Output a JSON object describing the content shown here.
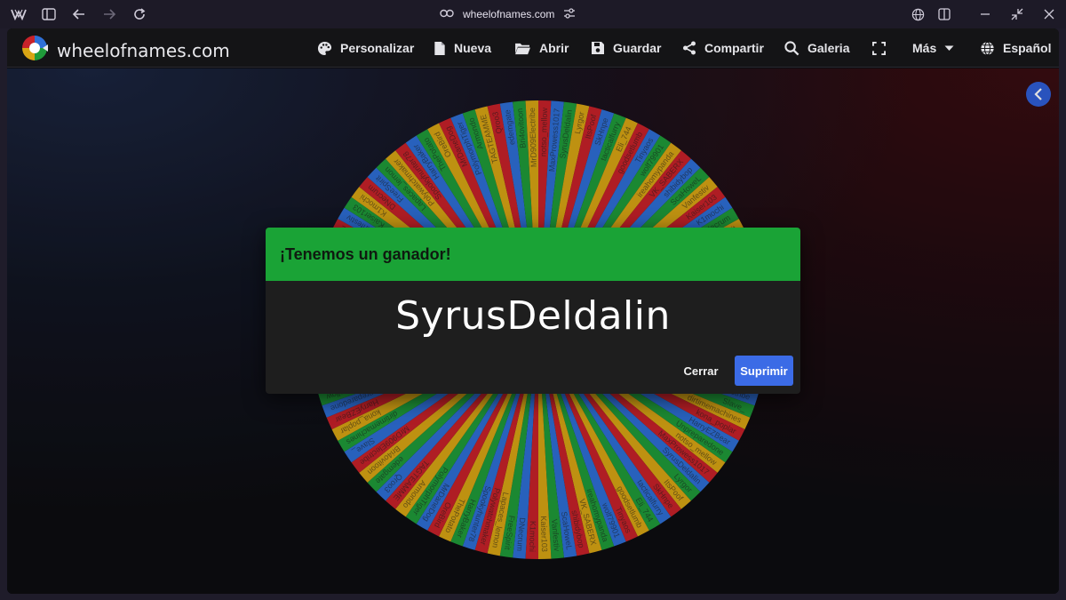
{
  "browser": {
    "url": "wheelofnames.com"
  },
  "app": {
    "brand_name": "wheelofnames.com",
    "nav": [
      {
        "label": "Personalizar",
        "icon": "palette-icon"
      },
      {
        "label": "Nueva",
        "icon": "file-icon"
      },
      {
        "label": "Abrir",
        "icon": "folder-icon"
      },
      {
        "label": "Guardar",
        "icon": "save-icon"
      },
      {
        "label": "Compartir",
        "icon": "share-icon"
      },
      {
        "label": "Galeria",
        "icon": "search-icon"
      },
      {
        "label": "",
        "icon": "fullscreen-icon"
      },
      {
        "label": "Más",
        "icon": "caret-down-icon"
      },
      {
        "label": "Español",
        "icon": "globe-icon"
      }
    ]
  },
  "wheel": {
    "segment_colors": [
      "#c8222a",
      "#2e6fd6",
      "#1f9b3a",
      "#d9a514"
    ],
    "visible_labels": [
      "notso_mellow",
      "MaxProwess1017",
      "SyrusDeldalin",
      "Lyrgor",
      "ItsPoof",
      "SkHnpe",
      "tacticalfurry",
      "Eli_744",
      "goodsetlumb",
      "Tinyaos",
      "wolf79901",
      "ireahomypanda",
      "VK_SABERX",
      "shibidybop",
      "ScaHoweL",
      "Vanfestiv",
      "Kaiser103",
      "K1mochi",
      "DNecrum",
      "FreeSpirit",
      "Lapaces_lemon",
      "Polywatchmaker",
      "Spookyhunter78",
      "HarryBaker",
      "ThePotato",
      "OreBird",
      "MrDaneDog",
      "PolymorphTiger",
      "Armondo",
      "TAGTEAMME",
      "Qroo3",
      "edemgate",
      "Bri4ovitoon",
      "MrD909Electribe",
      "Slave_",
      "dirtimemachines",
      "kona_poplar",
      "HarryEZBear",
      "Unpreparedone"
    ]
  },
  "dialog": {
    "title": "¡Tenemos un ganador!",
    "winner": "SyrusDeldalin",
    "close_label": "Cerrar",
    "delete_label": "Suprimir"
  }
}
